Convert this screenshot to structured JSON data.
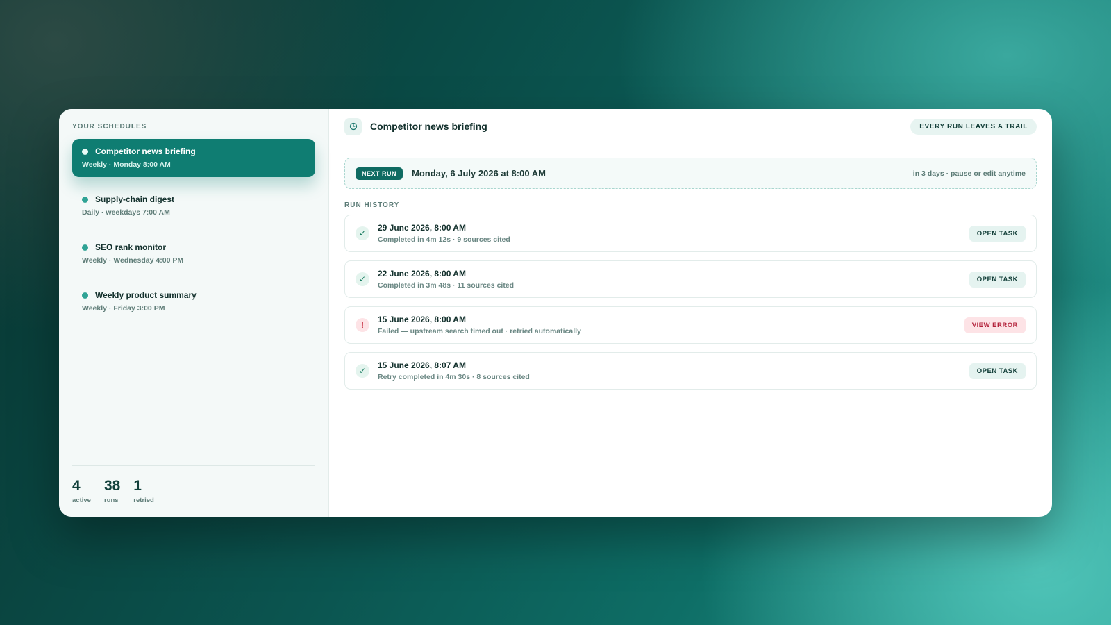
{
  "sidebar": {
    "heading": "YOUR SCHEDULES",
    "items": [
      {
        "name": "Competitor news briefing",
        "meta": "Weekly · Monday 8:00 AM",
        "active": true
      },
      {
        "name": "Supply-chain digest",
        "meta": "Daily · weekdays 7:00 AM",
        "active": false
      },
      {
        "name": "SEO rank monitor",
        "meta": "Weekly · Wednesday 4:00 PM",
        "active": false
      },
      {
        "name": "Weekly product summary",
        "meta": "Weekly · Friday 3:00 PM",
        "active": false
      }
    ],
    "stats": [
      {
        "value": "4",
        "label": "active"
      },
      {
        "value": "38",
        "label": "runs"
      },
      {
        "value": "1",
        "label": "retried"
      }
    ]
  },
  "header": {
    "icon": "clock-icon",
    "title": "Competitor news briefing",
    "badge": "EVERY RUN LEAVES A TRAIL"
  },
  "next_run": {
    "label": "NEXT RUN",
    "date": "Monday, 6 July 2026 at 8:00 AM",
    "note": "in 3 days · pause or edit anytime"
  },
  "history": {
    "heading": "RUN HISTORY",
    "runs": [
      {
        "status": "success",
        "icon": "✓",
        "title": "29 June 2026, 8:00 AM",
        "desc": "Completed in 4m 12s · 9 sources cited",
        "action": "OPEN TASK"
      },
      {
        "status": "success",
        "icon": "✓",
        "title": "22 June 2026, 8:00 AM",
        "desc": "Completed in 3m 48s · 11 sources cited",
        "action": "OPEN TASK"
      },
      {
        "status": "failed",
        "icon": "!",
        "title": "15 June 2026, 8:00 AM",
        "desc": "Failed — upstream search timed out · retried automatically",
        "action": "VIEW ERROR"
      },
      {
        "status": "success",
        "icon": "✓",
        "title": "15 June 2026, 8:07 AM",
        "desc": "Retry completed in 4m 30s · 8 sources cited",
        "action": "OPEN TASK"
      }
    ]
  },
  "colors": {
    "accent": "#0f7d72",
    "success": "#14795d",
    "error": "#c42b3e"
  }
}
